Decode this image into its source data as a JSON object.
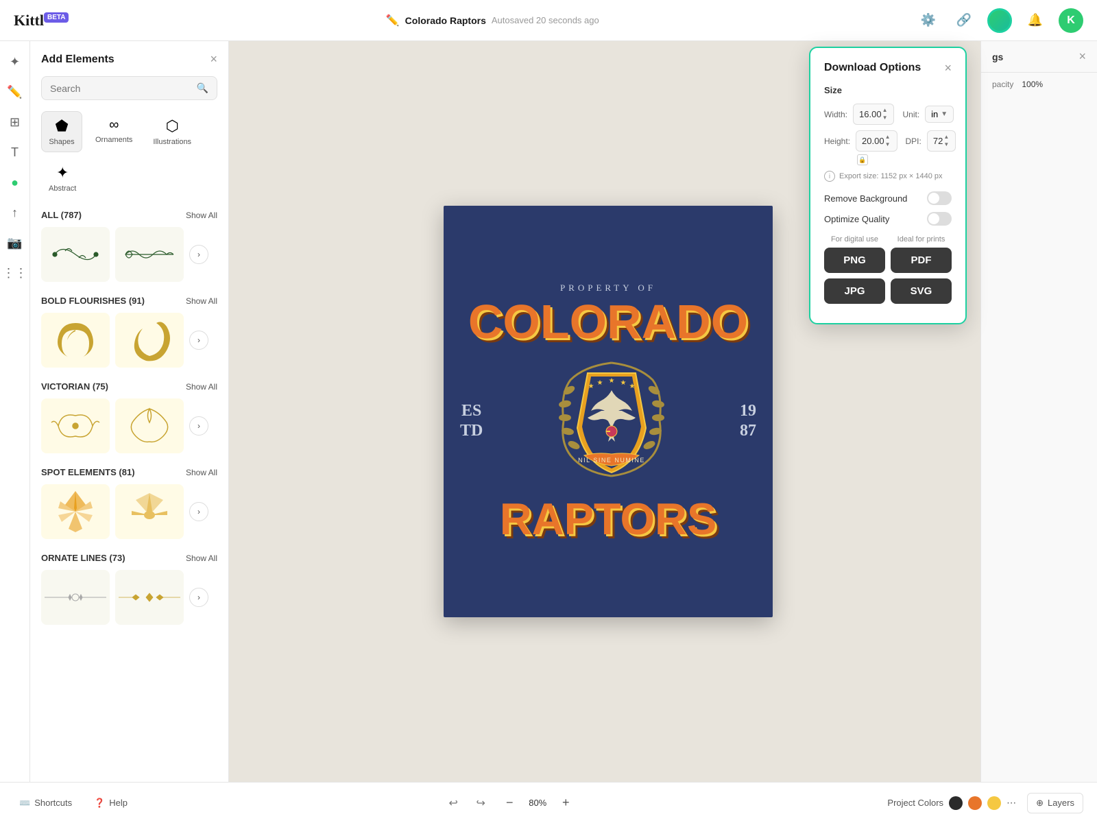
{
  "app": {
    "name": "Kittl",
    "beta_label": "BETA"
  },
  "header": {
    "project_name": "Colorado Raptors",
    "autosave": "Autosaved 20 seconds ago",
    "close_label": "×"
  },
  "left_panel": {
    "title": "Add Elements",
    "search_placeholder": "Search",
    "close_icon": "×",
    "categories": [
      {
        "id": "shapes",
        "label": "Shapes",
        "icon": "⬟"
      },
      {
        "id": "ornaments",
        "label": "Ornaments",
        "icon": "∞"
      },
      {
        "id": "illustrations",
        "label": "Illustrations",
        "icon": "⬡"
      },
      {
        "id": "abstract",
        "label": "Abstract",
        "icon": "✦"
      }
    ],
    "sections": [
      {
        "id": "all",
        "title": "ALL (787)",
        "show_all": "Show All"
      },
      {
        "id": "bold_flourishes",
        "title": "BOLD FLOURISHES (91)",
        "show_all": "Show All"
      },
      {
        "id": "victorian",
        "title": "VICTORIAN (75)",
        "show_all": "Show All"
      },
      {
        "id": "spot_elements",
        "title": "SPOT ELEMENTS (81)",
        "show_all": "Show All"
      },
      {
        "id": "ornate_lines",
        "title": "ORNATE LINES (73)",
        "show_all": "Show All"
      }
    ]
  },
  "download_modal": {
    "title": "Download Options",
    "close_icon": "×",
    "size_label": "Size",
    "width_label": "Width:",
    "width_value": "16.00",
    "height_label": "Height:",
    "height_value": "20.00",
    "unit_label": "Unit:",
    "unit_value": "in",
    "dpi_label": "DPI:",
    "dpi_value": "72",
    "export_size": "Export size: 1152 px × 1440 px",
    "remove_bg_label": "Remove Background",
    "optimize_label": "Optimize Quality",
    "digital_label": "For digital use",
    "prints_label": "Ideal for prints",
    "png_label": "PNG",
    "jpg_label": "JPG",
    "pdf_label": "PDF",
    "svg_label": "SVG"
  },
  "right_panel": {
    "title": "gs",
    "opacity_label": "pacity",
    "opacity_value": "100%"
  },
  "canvas": {
    "design_text": {
      "property_of": "PROPERTY OF",
      "colorado": "COLORADO",
      "est": "ES\nTD",
      "year": "19\n87",
      "raptors": "RAPTORS",
      "motto": "NIL SINE NUMINE"
    }
  },
  "bottom_bar": {
    "shortcuts_label": "Shortcuts",
    "help_label": "Help",
    "undo_icon": "↩",
    "redo_icon": "↪",
    "zoom_out": "−",
    "zoom_in": "+",
    "zoom_value": "80%",
    "project_colors_label": "Project Colors",
    "layers_label": "Layers"
  },
  "colors": {
    "accent_green": "#1dd1a1",
    "orange": "#e8752a",
    "gold": "#f5c842",
    "navy": "#2b3a6b",
    "dark_btn": "#3a3a3a"
  }
}
